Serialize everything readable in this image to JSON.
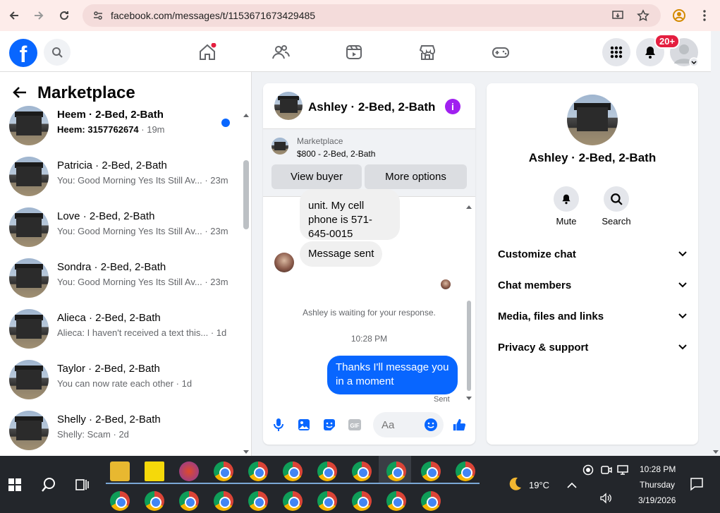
{
  "browser": {
    "url": "facebook.com/messages/t/1153671673429485"
  },
  "header": {
    "notifications_badge": "20+",
    "logo_letter": "f"
  },
  "left_panel": {
    "title": "Marketplace",
    "conversations": [
      {
        "name": "Heem · 2-Bed, 2-Bath",
        "snippet": "Heem: 3157762674",
        "time": "19m",
        "unread": true
      },
      {
        "name": "Patricia · 2-Bed, 2-Bath",
        "snippet": "You: Good Morning Yes Its Still Av...",
        "time": "23m",
        "unread": false
      },
      {
        "name": "Love · 2-Bed, 2-Bath",
        "snippet": "You: Good Morning Yes Its Still Av...",
        "time": "23m",
        "unread": false
      },
      {
        "name": "Sondra · 2-Bed, 2-Bath",
        "snippet": "You: Good Morning Yes Its Still Av...",
        "time": "23m",
        "unread": false
      },
      {
        "name": "Alieca · 2-Bed, 2-Bath",
        "snippet": "Alieca: I haven't received a text this...",
        "time": "1d",
        "unread": false
      },
      {
        "name": "Taylor · 2-Bed, 2-Bath",
        "snippet": "You can now rate each other",
        "time": "1d",
        "unread": false
      },
      {
        "name": "Shelly · 2-Bed, 2-Bath",
        "snippet": "Shelly: Scam",
        "time": "2d",
        "unread": false
      }
    ]
  },
  "chat": {
    "name": "Ashley · 2-Bed, 2-Bath",
    "marketplace_label": "Marketplace",
    "listing": "$800 - 2-Bed, 2-Bath",
    "view_buyer": "View buyer",
    "more_options": "More options",
    "msg_partial_1": "unit. My cell",
    "msg_partial_2": "phone is 571-",
    "msg_partial_3": "645-0015",
    "msg_sent": "Message sent",
    "waiting": "Ashley is waiting for your response.",
    "timestamp": "10:28 PM",
    "outgoing_1": "Thanks I'll message you",
    "outgoing_2": "in a moment",
    "sent_status": "Sent",
    "composer_placeholder": "Aa"
  },
  "right_panel": {
    "name": "Ashley · 2-Bed, 2-Bath",
    "mute": "Mute",
    "search": "Search",
    "sections": [
      "Customize chat",
      "Chat members",
      "Media, files and links",
      "Privacy & support"
    ]
  },
  "taskbar": {
    "weather": "19°C",
    "time": "10:28 PM",
    "day": "Thursday",
    "date": "3/19/2026"
  }
}
